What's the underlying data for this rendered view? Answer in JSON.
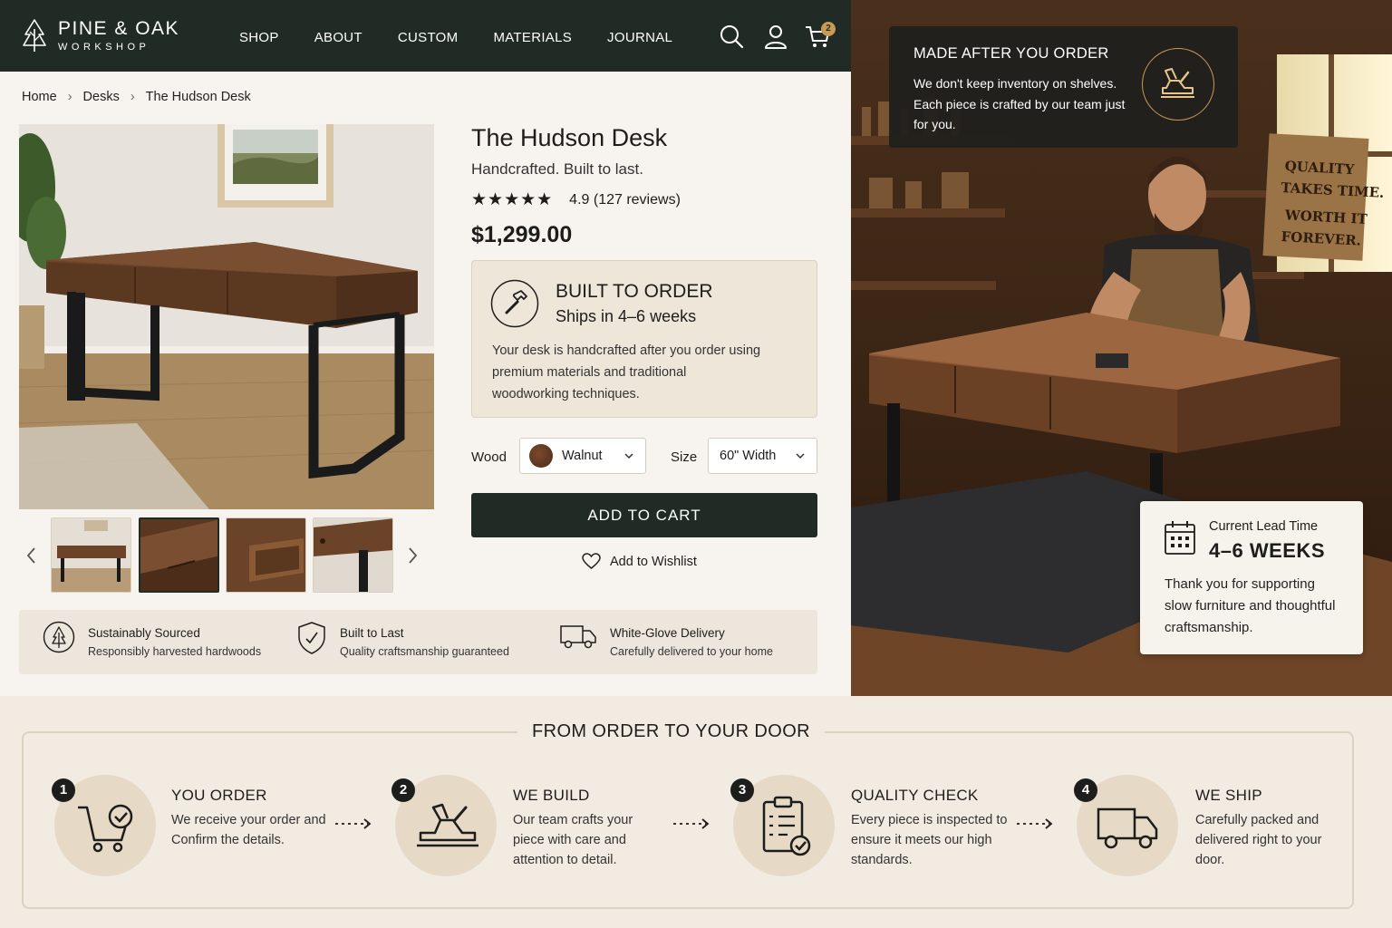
{
  "header": {
    "brand": "PINE & OAK",
    "brand_sub": "WORKSHOP",
    "nav": [
      "SHOP",
      "ABOUT",
      "CUSTOM",
      "MATERIALS",
      "JOURNAL"
    ],
    "cart_count": "2"
  },
  "breadcrumb": [
    "Home",
    "Desks",
    "The Hudson Desk"
  ],
  "product": {
    "title": "The Hudson Desk",
    "tagline": "Handcrafted. Built to last.",
    "stars": "★★★★★",
    "rating_value": 4.9,
    "rating": "4.9 (127 reviews)",
    "price": "$1,299.00",
    "built": {
      "title": "BUILT TO ORDER",
      "subtitle": "Ships in 4–6 weeks",
      "body": "Your desk is handcrafted after you order using premium materials and traditional woodworking techniques."
    },
    "wood_label": "Wood",
    "wood_value": "Walnut",
    "size_label": "Size",
    "size_value": "60\" Width",
    "add_to_cart": "ADD TO CART",
    "wishlist": "Add to Wishlist"
  },
  "features": [
    {
      "title": "Sustainably Sourced",
      "desc": "Responsibly harvested hardwoods"
    },
    {
      "title": "Built to Last",
      "desc": "Quality craftsmanship guaranteed"
    },
    {
      "title": "White-Glove Delivery",
      "desc": "Carefully delivered to your home"
    }
  ],
  "made_card": {
    "title": "MADE AFTER YOU ORDER",
    "body": "We don't keep inventory on shelves. Each piece is crafted by our team just for you."
  },
  "shop_sign": [
    "QUALITY",
    "TAKES TIME.",
    "WORTH IT",
    "FOREVER."
  ],
  "lead_card": {
    "label": "Current Lead Time",
    "value": "4–6 WEEKS",
    "body": "Thank you for supporting slow furniture and thoughtful craftsmanship."
  },
  "process": {
    "title": "FROM ORDER TO YOUR DOOR",
    "steps": [
      {
        "num": "1",
        "title": "YOU ORDER",
        "body": "We receive your order and Confirm the details."
      },
      {
        "num": "2",
        "title": "WE BUILD",
        "body": "Our team crafts your piece with care and attention to detail."
      },
      {
        "num": "3",
        "title": "QUALITY CHECK",
        "body": "Every piece is inspected to ensure it meets our high standards."
      },
      {
        "num": "4",
        "title": "WE SHIP",
        "body": "Carefully packed and delivered right to your door."
      }
    ]
  },
  "colors": {
    "brand_dark": "#1f2b24",
    "accent_gold": "#c99a53",
    "cream": "#f1ebe2",
    "walnut": "#6b4329"
  }
}
